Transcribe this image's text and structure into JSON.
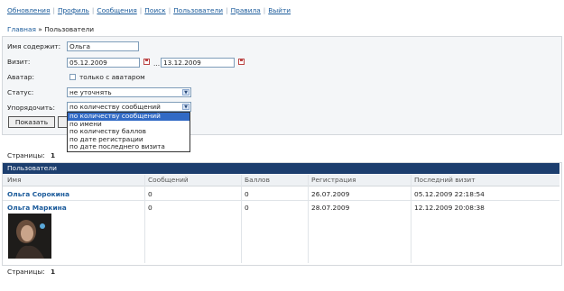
{
  "nav": [
    "Обновления",
    "Профиль",
    "Сообщения",
    "Поиск",
    "Пользователи",
    "Правила",
    "Выйти"
  ],
  "breadcrumb": {
    "home": "Главная",
    "sep": "»",
    "current": "Пользователи"
  },
  "form": {
    "name_label": "Имя содержит:",
    "name_value": "Ольга",
    "visit_label": "Визит:",
    "date_from": "05.12.2009",
    "date_to": "13.12.2009",
    "date_sep": "...",
    "avatar_label": "Аватар:",
    "avatar_checkbox_label": "только с аватаром",
    "status_label": "Статус:",
    "status_value": "не уточнять",
    "order_label": "Упорядочить:",
    "order_value": "по количеству сообщений",
    "order_options": [
      "по количеству сообщений",
      "по имени",
      "по количеству баллов",
      "по дате регистрации",
      "по дате последнего визита"
    ],
    "show_button": "Показать"
  },
  "pages_top": {
    "label": "Страницы:",
    "value": "1"
  },
  "table": {
    "title": "Пользователи",
    "columns": [
      "Имя",
      "Сообщений",
      "Баллов",
      "Регистрация",
      "Последний визит"
    ],
    "rows": [
      {
        "name": "Ольга Сорокина",
        "posts": "0",
        "points": "0",
        "registered": "26.07.2009",
        "last_visit": "05.12.2009 22:18:54"
      },
      {
        "name": "Ольга Маркина",
        "posts": "0",
        "points": "0",
        "registered": "28.07.2009",
        "last_visit": "12.12.2009 20:08:38"
      }
    ]
  },
  "pages_bottom": {
    "label": "Страницы:",
    "value": "1"
  }
}
